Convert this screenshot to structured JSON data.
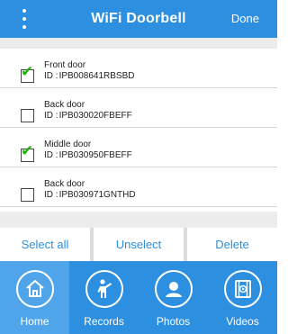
{
  "header": {
    "title": "WiFi Doorbell",
    "done_label": "Done"
  },
  "devices": [
    {
      "name": "Front door",
      "id_prefix": "ID :",
      "id": "IPB008641RBSBD",
      "checked": true
    },
    {
      "name": "Back door",
      "id_prefix": "ID :",
      "id": "IPB030020FBEFF",
      "checked": false
    },
    {
      "name": "Middle door",
      "id_prefix": "ID :",
      "id": "IPB030950FBEFF",
      "checked": true
    },
    {
      "name": "Back door",
      "id_prefix": "ID :",
      "id": "IPB030971GNTHD",
      "checked": false
    }
  ],
  "actions": {
    "select_all": "Select all",
    "unselect": "Unselect",
    "delete": "Delete"
  },
  "tabs": [
    {
      "label": "Home",
      "icon": "home-icon",
      "active": true
    },
    {
      "label": "Records",
      "icon": "person-pointing-icon",
      "active": false
    },
    {
      "label": "Photos",
      "icon": "user-photo-icon",
      "active": false
    },
    {
      "label": "Videos",
      "icon": "film-icon",
      "active": false
    }
  ],
  "colors": {
    "accent": "#2d8fe0",
    "check": "#1fb50b"
  }
}
